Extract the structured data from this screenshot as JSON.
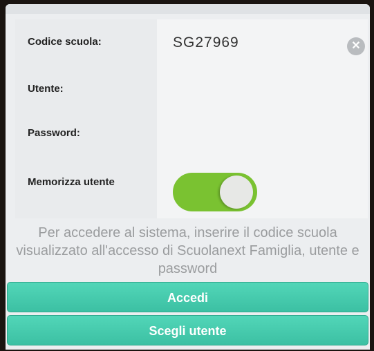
{
  "form": {
    "codice_label": "Codice scuola:",
    "codice_value": "SG27969",
    "clear_icon": "clear-icon",
    "utente_label": "Utente:",
    "utente_value": "",
    "password_label": "Password:",
    "password_value": "",
    "memorizza_label": "Memorizza utente",
    "memorizza_on": true,
    "toggle_color": "#7ac231"
  },
  "info": {
    "text": "Per accedere al sistema, inserire il codice scuola visualizzato all'accesso di Scuolanext Famiglia, utente e password"
  },
  "buttons": {
    "accedi": "Accedi",
    "scegli": "Scegli utente",
    "color": "#46cbad"
  }
}
